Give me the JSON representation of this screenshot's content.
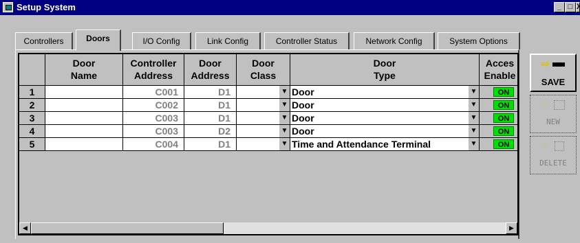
{
  "window": {
    "title": "Setup System",
    "controls": [
      "_",
      "□",
      "X"
    ]
  },
  "tabs": [
    {
      "label": "Controllers",
      "active": false
    },
    {
      "label": "Doors",
      "active": true
    },
    {
      "label": "I/O Config",
      "active": false
    },
    {
      "label": "Link Config",
      "active": false
    },
    {
      "label": "Controller Status",
      "active": false
    },
    {
      "label": "Network Config",
      "active": false
    },
    {
      "label": "System Options",
      "active": false
    }
  ],
  "grid": {
    "headers": [
      {
        "line1": "",
        "line2": ""
      },
      {
        "line1": "Door",
        "line2": "Name"
      },
      {
        "line1": "Controller",
        "line2": "Address"
      },
      {
        "line1": "Door",
        "line2": "Address"
      },
      {
        "line1": "Door",
        "line2": "Class"
      },
      {
        "line1": "Door",
        "line2": "Type"
      },
      {
        "line1": "Acces",
        "line2": "Enable"
      }
    ],
    "rows": [
      {
        "num": "1",
        "name": "",
        "controller": "C001",
        "door_address": "D1",
        "door_class": "",
        "door_type": "Door",
        "access": "ON"
      },
      {
        "num": "2",
        "name": "",
        "controller": "C002",
        "door_address": "D1",
        "door_class": "",
        "door_type": "Door",
        "access": "ON"
      },
      {
        "num": "3",
        "name": "",
        "controller": "C003",
        "door_address": "D1",
        "door_class": "",
        "door_type": "Door",
        "access": "ON"
      },
      {
        "num": "4",
        "name": "",
        "controller": "C003",
        "door_address": "D2",
        "door_class": "",
        "door_type": "Door",
        "access": "ON"
      },
      {
        "num": "5",
        "name": "",
        "controller": "C004",
        "door_address": "D1",
        "door_class": "",
        "door_type": "Time and Attendance Terminal",
        "access": "ON"
      }
    ]
  },
  "buttons": {
    "save": {
      "label": "SAVE",
      "enabled": true
    },
    "new": {
      "label": "NEW",
      "enabled": false
    },
    "delete": {
      "label": "DELETE",
      "enabled": false
    }
  },
  "colors": {
    "titlebar": "#000080",
    "on_badge": "#00e000"
  }
}
